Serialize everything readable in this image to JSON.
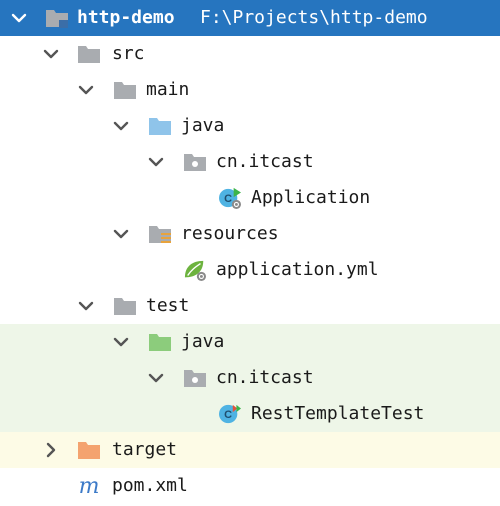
{
  "project": {
    "name": "http-demo",
    "path": "F:\\Projects\\http-demo"
  },
  "tree": {
    "src": "src",
    "main": "main",
    "main_java": "java",
    "main_package": "cn.itcast",
    "application_class": "Application",
    "resources": "resources",
    "application_yml": "application.yml",
    "test": "test",
    "test_java": "java",
    "test_package": "cn.itcast",
    "test_class": "RestTemplateTest",
    "target": "target",
    "pom": "pom.xml"
  },
  "icons": {
    "module": "module-folder-icon",
    "folder": "folder-icon",
    "source_root": "source-root-folder-icon",
    "package": "package-icon",
    "spring_boot_class": "spring-boot-class-icon",
    "resources_root": "resources-root-folder-icon",
    "spring_config": "spring-config-icon",
    "test_root": "test-root-folder-icon",
    "test_class": "test-class-icon",
    "excluded_folder": "excluded-folder-icon",
    "maven": "maven-icon"
  },
  "colors": {
    "selection": "#2675bf",
    "test_highlight": "#eef6e8",
    "excluded_highlight": "#fdfbe6",
    "folder_gray": "#a9acb0",
    "source_blue": "#8fc4ea",
    "test_green": "#8ccc7c",
    "excluded_orange": "#f4a36f",
    "class_cyan": "#4fb3e3",
    "spring_green": "#6db33f",
    "maven_blue": "#3c7ac8"
  }
}
